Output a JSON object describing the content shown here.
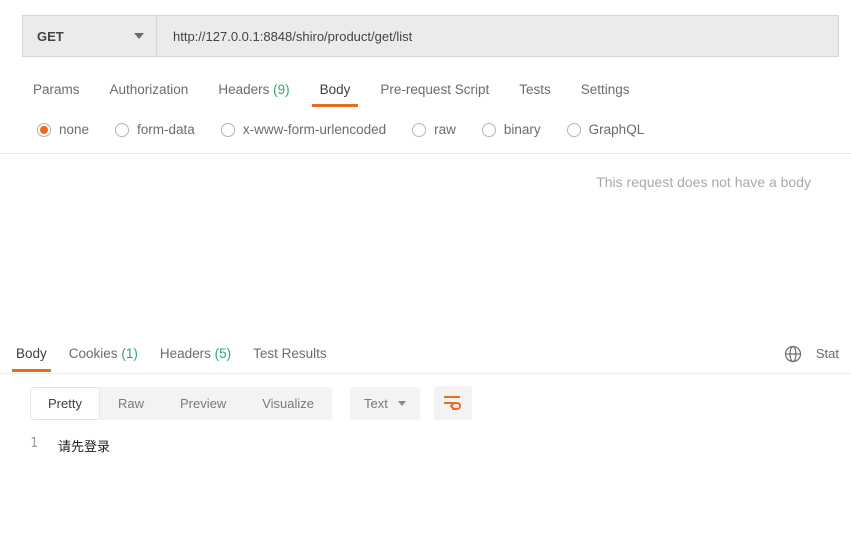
{
  "request": {
    "method": "GET",
    "url": "http://127.0.0.1:8848/shiro/product/get/list",
    "tabs": {
      "params": "Params",
      "authorization": "Authorization",
      "headers_label": "Headers",
      "headers_count": "(9)",
      "body": "Body",
      "prerequest": "Pre-request Script",
      "tests": "Tests",
      "settings": "Settings"
    },
    "body_types": {
      "none": "none",
      "form_data": "form-data",
      "urlencoded": "x-www-form-urlencoded",
      "raw": "raw",
      "binary": "binary",
      "graphql": "GraphQL"
    },
    "no_body_msg": "This request does not have a body"
  },
  "response": {
    "tabs": {
      "body": "Body",
      "cookies_label": "Cookies",
      "cookies_count": "(1)",
      "headers_label": "Headers",
      "headers_count": "(5)",
      "test_results": "Test Results"
    },
    "right": {
      "status_label": "Stat"
    },
    "view_modes": {
      "pretty": "Pretty",
      "raw": "Raw",
      "preview": "Preview",
      "visualize": "Visualize"
    },
    "format": "Text",
    "lines": [
      {
        "num": "1",
        "text": "请先登录"
      }
    ]
  }
}
